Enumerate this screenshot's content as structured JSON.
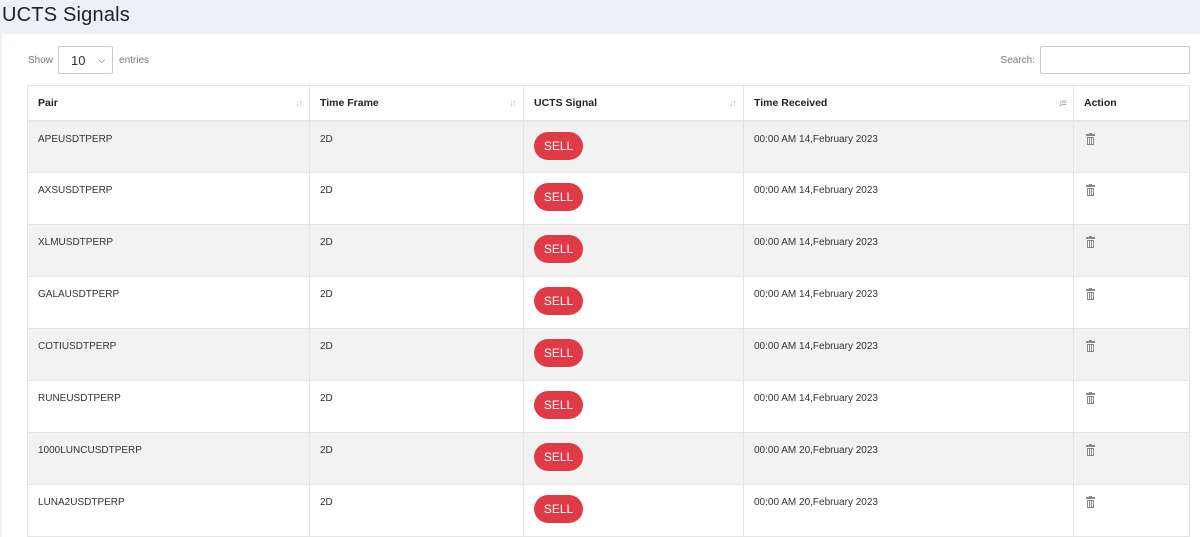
{
  "header": {
    "title": "UCTS Signals"
  },
  "controls": {
    "show_label": "Show",
    "entries_value": "10",
    "entries_label": "entries",
    "search_label": "Search:",
    "search_value": ""
  },
  "table": {
    "columns": [
      "Pair",
      "Time Frame",
      "UCTS Signal",
      "Time Received",
      "Action"
    ],
    "rows": [
      {
        "pair": "APEUSDTPERP",
        "timeframe": "2D",
        "signal": "SELL",
        "received": "00:00 AM 14,February 2023"
      },
      {
        "pair": "AXSUSDTPERP",
        "timeframe": "2D",
        "signal": "SELL",
        "received": "00:00 AM 14,February 2023"
      },
      {
        "pair": "XLMUSDTPERP",
        "timeframe": "2D",
        "signal": "SELL",
        "received": "00:00 AM 14,February 2023"
      },
      {
        "pair": "GALAUSDTPERP",
        "timeframe": "2D",
        "signal": "SELL",
        "received": "00:00 AM 14,February 2023"
      },
      {
        "pair": "COTIUSDTPERP",
        "timeframe": "2D",
        "signal": "SELL",
        "received": "00:00 AM 14,February 2023"
      },
      {
        "pair": "RUNEUSDTPERP",
        "timeframe": "2D",
        "signal": "SELL",
        "received": "00:00 AM 14,February 2023"
      },
      {
        "pair": "1000LUNCUSDTPERP",
        "timeframe": "2D",
        "signal": "SELL",
        "received": "00:00 AM 20,February 2023"
      },
      {
        "pair": "LUNA2USDTPERP",
        "timeframe": "2D",
        "signal": "SELL",
        "received": "00:00 AM 20,February 2023"
      }
    ]
  },
  "colors": {
    "sell": "#e03a47",
    "background": "#eef0f8",
    "row_stripe": "#f2f2f2"
  },
  "icons": {
    "action": "trash-icon",
    "sort": "sort-icon",
    "sort_active": "sort-desc-icon",
    "dropdown": "chevron-down-icon"
  }
}
